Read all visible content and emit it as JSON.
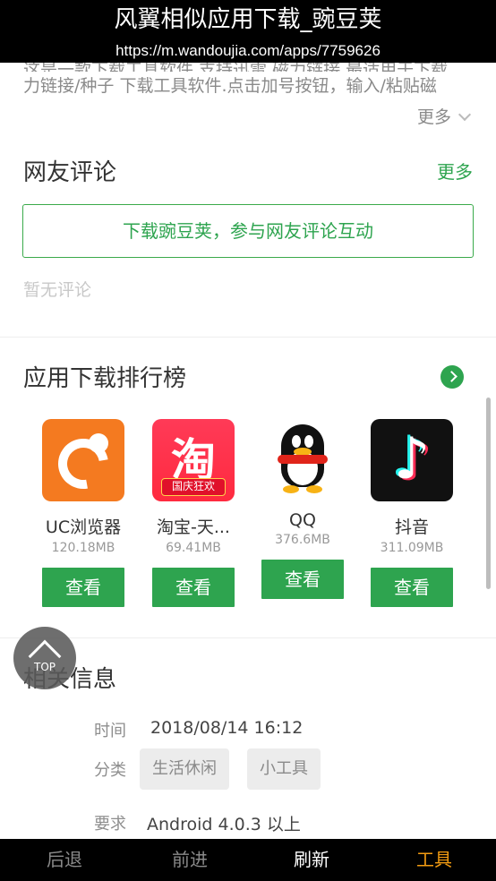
{
  "overlay": {
    "title": "风翼相似应用下载_豌豆荚",
    "url": "https://m.wandoujia.com/apps/7759626"
  },
  "description": {
    "line1_partial": "这是一款下载工具软件 支持迅雷 磁力链接 最适用于下载",
    "line2": "力链接/种子 下载工具软件.点击加号按钮，输入/粘贴磁",
    "more_label": "更多"
  },
  "comments": {
    "title": "网友评论",
    "more_label": "更多",
    "cta_label": "下载豌豆荚，参与网友评论互动",
    "empty_label": "暂无评论"
  },
  "ranking": {
    "title": "应用下载排行榜",
    "apps": [
      {
        "name": "UC浏览器",
        "size": "120.18MB",
        "button": "查看",
        "icon": "uc-browser-icon"
      },
      {
        "name": "淘宝-天...",
        "size": "69.41MB",
        "button": "查看",
        "icon": "taobao-icon",
        "icon_text": "淘",
        "icon_band": "国庆狂欢"
      },
      {
        "name": "QQ",
        "size": "376.6MB",
        "button": "查看",
        "icon": "qq-icon"
      },
      {
        "name": "抖音",
        "size": "311.09MB",
        "button": "查看",
        "icon": "douyin-icon",
        "icon_text": "♪"
      }
    ]
  },
  "top_button": {
    "label": "TOP"
  },
  "related": {
    "title": "相关信息",
    "time_label": "时间",
    "time_value": "2018/08/14 16:12",
    "category_label": "分类",
    "tags": [
      "生活休闲",
      "小工具"
    ],
    "require_label": "要求",
    "require_value": "Android 4.0.3 以上"
  },
  "bottom_nav": {
    "back": "后退",
    "forward": "前进",
    "refresh": "刷新",
    "tools": "工具"
  },
  "colors": {
    "accent_green": "#2ea44f",
    "tools_orange": "#f39c12"
  }
}
